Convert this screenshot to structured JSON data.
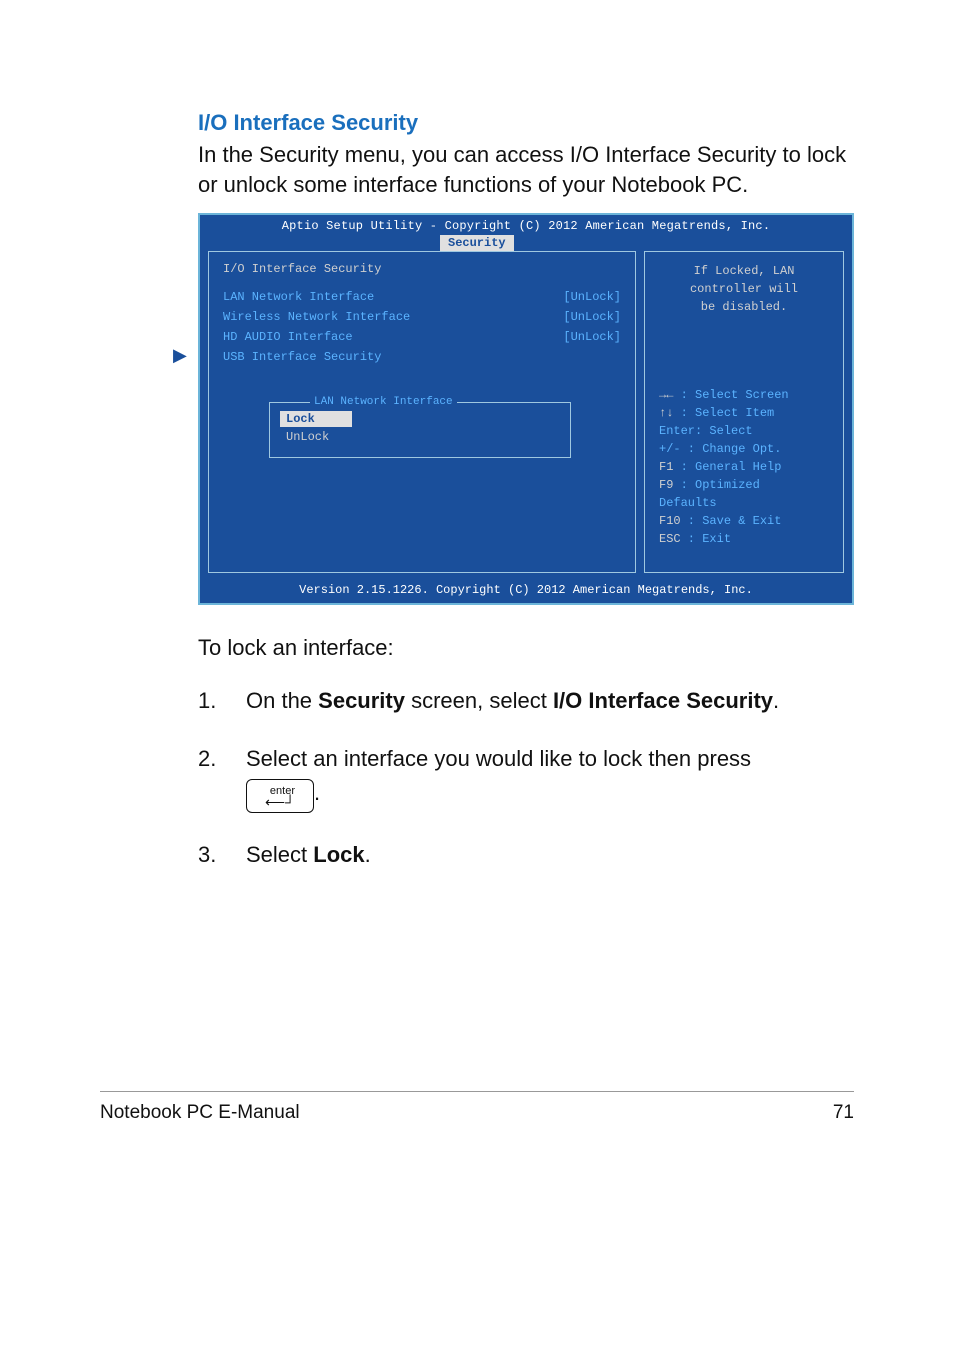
{
  "section_title": "I/O Interface Security",
  "intro": "In the Security menu, you can access I/O Interface Security to lock or unlock some interface functions of your Notebook PC.",
  "bios": {
    "top": "Aptio Setup Utility - Copyright (C) 2012 American Megatrends, Inc.",
    "tab": "Security",
    "header": "I/O Interface Security",
    "items": [
      {
        "label": "LAN Network Interface",
        "value": "[UnLock]"
      },
      {
        "label": "Wireless Network Interface",
        "value": "[UnLock]"
      },
      {
        "label": "HD AUDIO Interface",
        "value": "[UnLock]"
      },
      {
        "label": "USB Interface Security",
        "value": ""
      }
    ],
    "popup": {
      "title": "LAN Network Interface",
      "options": [
        "Lock",
        "UnLock"
      ],
      "selected": 0
    },
    "help_desc1": "If Locked, LAN",
    "help_desc2": "controller will",
    "help_desc3": "be disabled.",
    "keys": {
      "k1a": "→←",
      "k1b": " : Select Screen",
      "k2a": "↑↓",
      "k2b": " : Select Item",
      "k3": "Enter: Select",
      "k4": "+/-  : Change Opt.",
      "k5a": "F1",
      "k5b": "   : General Help",
      "k6a": "F9",
      "k6b": "   : Optimized",
      "k6c": "Defaults",
      "k7a": "F10",
      "k7b": "  : Save & Exit",
      "k8a": "ESC",
      "k8b": "  : Exit"
    },
    "footer": "Version 2.15.1226. Copyright (C) 2012 American Megatrends, Inc."
  },
  "lock_heading": "To lock an interface:",
  "steps": {
    "n1": "1.",
    "s1_a": "On the ",
    "s1_b": "Security",
    "s1_c": " screen, select ",
    "s1_d": "I/O Interface Security",
    "s1_e": ".",
    "n2": "2.",
    "s2": "Select an interface you would like to lock then press ",
    "key_label": "enter",
    "key_arrow": "↵",
    "s2_end": ".",
    "n3": "3.",
    "s3_a": "Select ",
    "s3_b": "Lock",
    "s3_c": "."
  },
  "footer_left": "Notebook PC E-Manual",
  "footer_right": "71"
}
